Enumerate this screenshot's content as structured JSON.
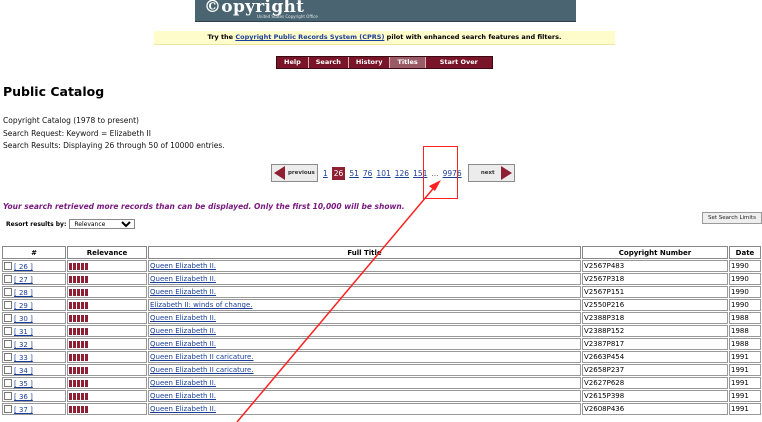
{
  "banner": {
    "logo": "Copyright",
    "sub": "United States Copyright Office"
  },
  "cprs": {
    "before": "Try the ",
    "link": "Copyright Public Records System (CPRS)",
    "after": " pilot with enhanced search features and filters."
  },
  "nav": [
    "Help",
    "Search",
    "History",
    "Titles",
    "Start Over"
  ],
  "page_title": "Public Catalog",
  "meta": {
    "catalog": "Copyright Catalog (1978 to present)",
    "request": "Search Request: Keyword = Elizabeth II",
    "results": "Search Results: Displaying 26 through 50 of 10000 entries."
  },
  "pager": {
    "prev": "previous",
    "next": "next",
    "pages": [
      "1",
      "26",
      "51",
      "76",
      "101",
      "126",
      "151",
      "...",
      "9976"
    ],
    "current": "26"
  },
  "notice": "Your search retrieved more records than can be displayed. Only the first 10,000 will be shown.",
  "resort": {
    "label": "Resort results by:",
    "value": "Relevance"
  },
  "limits_button": "Set Search Limits",
  "table": {
    "headers": [
      "#",
      "Relevance",
      "Full Title",
      "Copyright Number",
      "Date"
    ],
    "rows": [
      {
        "num": "[ 26 ]",
        "title": "Queen Elizabeth II.",
        "reg": "V2567P483",
        "date": "1990"
      },
      {
        "num": "[ 27 ]",
        "title": "Queen Elizabeth II.",
        "reg": "V2567P318",
        "date": "1990"
      },
      {
        "num": "[ 28 ]",
        "title": "Queen Elizabeth II.",
        "reg": "V2567P151",
        "date": "1990"
      },
      {
        "num": "[ 29 ]",
        "title": "Elizabeth II: winds of change.",
        "reg": "V2550P216",
        "date": "1990"
      },
      {
        "num": "[ 30 ]",
        "title": "Queen Elizabeth II.",
        "reg": "V2388P318",
        "date": "1988"
      },
      {
        "num": "[ 31 ]",
        "title": "Queen Elizabeth II.",
        "reg": "V2388P152",
        "date": "1988"
      },
      {
        "num": "[ 32 ]",
        "title": "Queen Elizabeth II.",
        "reg": "V2387P817",
        "date": "1988"
      },
      {
        "num": "[ 33 ]",
        "title": "Queen Elizabeth II caricature.",
        "reg": "V2663P454",
        "date": "1991"
      },
      {
        "num": "[ 34 ]",
        "title": "Queen Elizabeth II caricature.",
        "reg": "V2658P237",
        "date": "1991"
      },
      {
        "num": "[ 35 ]",
        "title": "Queen Elizabeth II.",
        "reg": "V2627P628",
        "date": "1991"
      },
      {
        "num": "[ 36 ]",
        "title": "Queen Elizabeth II.",
        "reg": "V2615P398",
        "date": "1991"
      },
      {
        "num": "[ 37 ]",
        "title": "Queen Elizabeth II.",
        "reg": "V2608P436",
        "date": "1991"
      }
    ]
  },
  "colors": {
    "nav": "#7a1428",
    "accent": "#8f1f33",
    "link": "#1a3f9a",
    "notice": "#7a1a80",
    "annotation": "#ff2020"
  }
}
